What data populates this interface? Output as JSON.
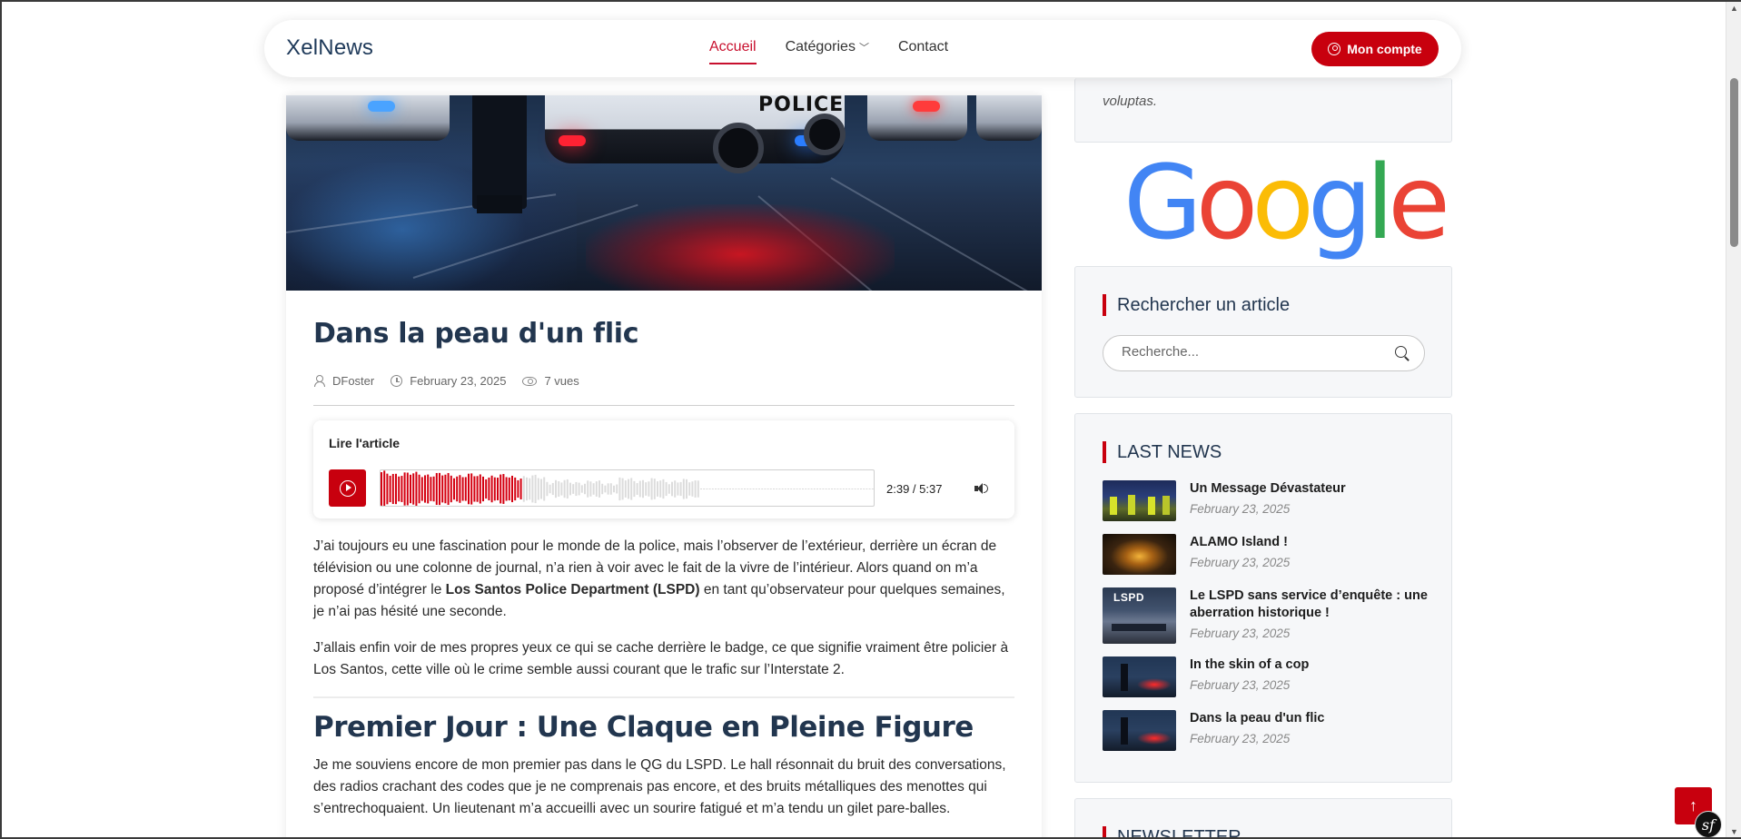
{
  "header": {
    "logo": "XelNews",
    "nav": [
      {
        "label": "Accueil",
        "active": true
      },
      {
        "label": "Catégories",
        "dropdown": true
      },
      {
        "label": "Contact"
      }
    ],
    "account_label": "Mon compte"
  },
  "article": {
    "title": "Dans la peau d'un flic",
    "author": "DFoster",
    "date": "February 23, 2025",
    "views": "7 vues",
    "hero_text": "POLICE",
    "player": {
      "title": "Lire l'article",
      "time": "2:39 / 5:37",
      "progress": 0.472
    },
    "paragraphs": [
      {
        "before": "J’ai toujours eu une fascination pour le monde de la police, mais l’observer de l’extérieur, derrière un écran de télévision ou une colonne de journal, n’a rien à voir avec le fait de la vivre de l’intérieur. Alors quand on m’a proposé d’intégrer le ",
        "bold": "Los Santos Police Department (LSPD)",
        "after": " en tant qu’observateur pour quelques semaines, je n’ai pas hésité une seconde."
      },
      {
        "text": "J’allais enfin voir de mes propres yeux ce qui se cache derrière le badge, ce que signifie vraiment être policier à Los Santos, cette ville où le crime semble aussi courant que le trafic sur l’Interstate 2."
      }
    ],
    "heading2": "Premier Jour : Une Claque en Pleine Figure",
    "paragraph3": "Je me souviens encore de mon premier pas dans le QG du LSPD. Le hall résonnait du bruit des conversations, des radios crachant des codes que je ne comprenais pas encore, et des bruits métalliques des menottes qui s’entrechoquaient. Un lieutenant m’a accueilli avec un sourire fatigué et m’a tendu un gilet pare-balles."
  },
  "sidebar": {
    "quote_tail": "voluptas.",
    "google_letters": [
      {
        "ch": "G",
        "color": "#4285F4"
      },
      {
        "ch": "o",
        "color": "#EA4335"
      },
      {
        "ch": "o",
        "color": "#FBBC05"
      },
      {
        "ch": "g",
        "color": "#4285F4"
      },
      {
        "ch": "l",
        "color": "#34A853"
      },
      {
        "ch": "e",
        "color": "#EA4335"
      }
    ],
    "search": {
      "heading": "Rechercher un article",
      "placeholder": "Recherche..."
    },
    "last_news": {
      "heading": "LAST NEWS",
      "items": [
        {
          "title": "Un Message Dévastateur",
          "date": "February 23, 2025"
        },
        {
          "title": "ALAMO Island !",
          "date": "February 23, 2025"
        },
        {
          "title": "Le LSPD sans service d’enquête : une aberration historique !",
          "date": "February 23, 2025",
          "thumb_text": "LSPD"
        },
        {
          "title": "In the skin of a cop",
          "date": "February 23, 2025"
        },
        {
          "title": "Dans la peau d'un flic",
          "date": "February 23, 2025"
        }
      ]
    },
    "newsletter_heading": "NEWSLETTER"
  },
  "colors": {
    "accent": "#c8000e",
    "heading": "#22364f"
  }
}
